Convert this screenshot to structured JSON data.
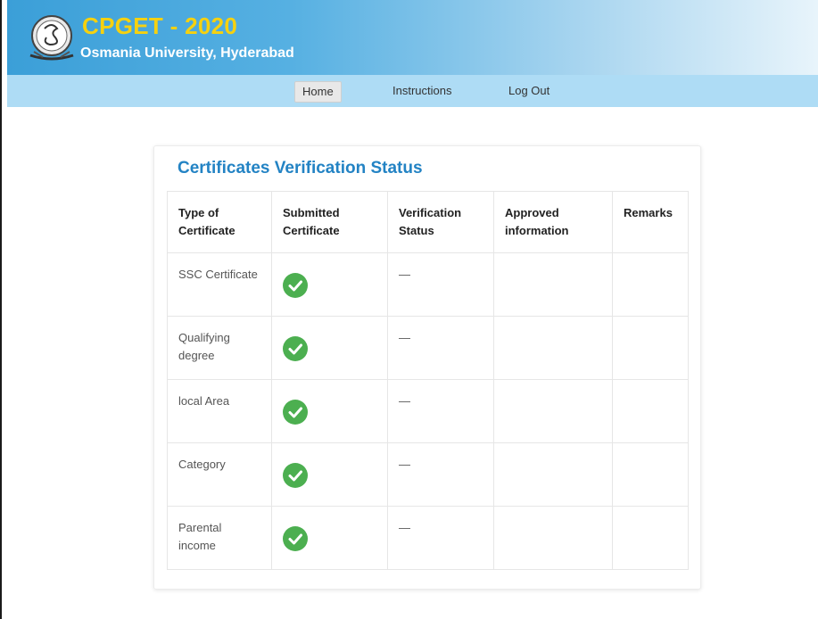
{
  "header": {
    "title": "CPGET - 2020",
    "subtitle": "Osmania University, Hyderabad"
  },
  "nav": {
    "items": [
      {
        "label": "Home",
        "active": true
      },
      {
        "label": "Instructions",
        "active": false
      },
      {
        "label": "Log Out",
        "active": false
      }
    ]
  },
  "card": {
    "title": "Certificates Verification Status"
  },
  "table": {
    "headers": [
      "Type of Certificate",
      "Submitted Certificate",
      "Verification Status",
      "Approved information",
      "Remarks"
    ],
    "rows": [
      {
        "type": "SSC Certificate",
        "submitted": "check-icon",
        "verification": "—",
        "approved": "",
        "remarks": ""
      },
      {
        "type": "Qualifying degree",
        "submitted": "check-icon",
        "verification": "—",
        "approved": "",
        "remarks": ""
      },
      {
        "type": "local Area",
        "submitted": "check-icon",
        "verification": "—",
        "approved": "",
        "remarks": ""
      },
      {
        "type": "Category",
        "submitted": "check-icon",
        "verification": "—",
        "approved": "",
        "remarks": ""
      },
      {
        "type": "Parental income",
        "submitted": "check-icon",
        "verification": "—",
        "approved": "",
        "remarks": ""
      }
    ]
  },
  "colors": {
    "title_yellow": "#f6d10f",
    "card_title_blue": "#2383c4",
    "check_green": "#4caf50",
    "navbar_bg": "#aedcf5"
  }
}
